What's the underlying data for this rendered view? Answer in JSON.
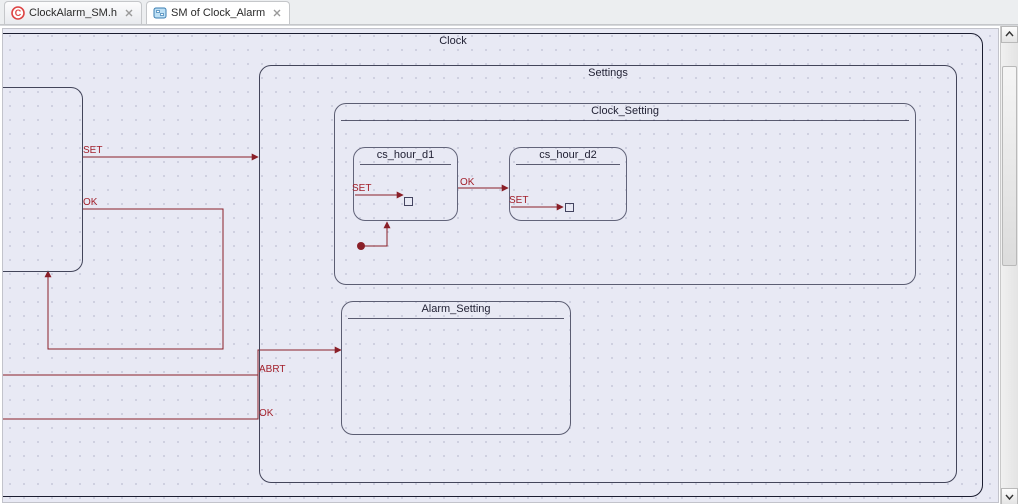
{
  "tabs": [
    {
      "label": "ClockAlarm_SM.h",
      "icon": "c-file"
    },
    {
      "label": "SM of Clock_Alarm",
      "icon": "sm-diagram"
    }
  ],
  "diagram": {
    "states": {
      "clock": {
        "label": "Clock"
      },
      "settings": {
        "label": "Settings"
      },
      "clock_setting": {
        "label": "Clock_Setting"
      },
      "alarm_setting": {
        "label": "Alarm_Setting"
      },
      "cs_hour_d1": {
        "label": "cs_hour_d1"
      },
      "cs_hour_d2": {
        "label": "cs_hour_d2"
      }
    },
    "events": {
      "set1": "SET",
      "ok1": "OK",
      "set_inner1": "SET",
      "set_inner2": "SET",
      "ok_between": "OK",
      "abrt": "ABRT",
      "ok2": "OK"
    }
  }
}
